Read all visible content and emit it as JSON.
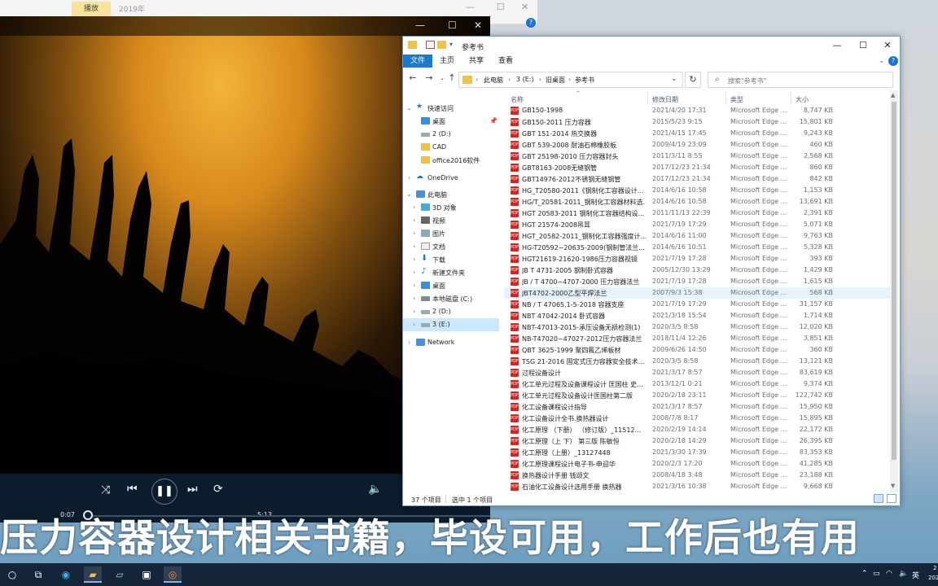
{
  "back_window": {
    "tab_label": "播放",
    "year_label": "2019年",
    "help": "?"
  },
  "player": {
    "time_elapsed": "0:07",
    "time_total": "5:13",
    "progress": 0.022
  },
  "explorer": {
    "title": "参考书",
    "ribbon_tabs": [
      "文件",
      "主页",
      "共享",
      "查看"
    ],
    "breadcrumb": [
      "此电脑",
      "3 (E:)",
      "旧桌面",
      "参考书"
    ],
    "search_placeholder": "搜索\"参考书\"",
    "nav": {
      "quick_access": "快速访问",
      "quick_items": [
        "桌面",
        "2 (D:)",
        "CAD",
        "office2016软件"
      ],
      "onedrive": "OneDrive",
      "this_pc": "此电脑",
      "pc_items": [
        "3D 对象",
        "视频",
        "图片",
        "文档",
        "下载",
        "新建文件夹",
        "桌面",
        "本地磁盘 (C:)",
        "2 (D:)",
        "3 (E:)"
      ],
      "network": "Network"
    },
    "columns": [
      "名称",
      "修改日期",
      "类型",
      "大小"
    ],
    "files": [
      {
        "name": "GB150-1998",
        "date": "2021/4/20 17:31",
        "type": "Microsoft Edge ...",
        "size": "8,747 KB"
      },
      {
        "name": "GB150-2011 压力容器",
        "date": "2015/5/23 9:15",
        "type": "Microsoft Edge ...",
        "size": "15,801 KB"
      },
      {
        "name": "GBT 151-2014 热交换器",
        "date": "2021/4/15 17:45",
        "type": "Microsoft Edge ...",
        "size": "9,243 KB"
      },
      {
        "name": "GBT 539-2008 耐油石棉橡胶板",
        "date": "2009/4/19 23:09",
        "type": "Microsoft Edge ...",
        "size": "460 KB"
      },
      {
        "name": "GBT 25198-2010 压力容器封头",
        "date": "2011/3/11 8:55",
        "type": "Microsoft Edge ...",
        "size": "2,568 KB"
      },
      {
        "name": "GBT8163-2008无缝钢管",
        "date": "2017/12/23 21:34",
        "type": "Microsoft Edge ...",
        "size": "860 KB"
      },
      {
        "name": "GBT14976-2012不锈钢无缝钢管",
        "date": "2017/12/23 21:34",
        "type": "Microsoft Edge ...",
        "size": "842 KB"
      },
      {
        "name": "HG_T20580-2011《钢制化工容器设计...",
        "date": "2014/6/16 10:58",
        "type": "Microsoft Edge ...",
        "size": "1,153 KB"
      },
      {
        "name": "HG/T_20581-2011_钢制化工容器材料选...",
        "date": "2014/6/16 10:58",
        "type": "Microsoft Edge ...",
        "size": "13,691 KB"
      },
      {
        "name": "HGT 20583-2011 钢制化工容器结构设...",
        "date": "2011/11/13 22:39",
        "type": "Microsoft Edge ...",
        "size": "2,391 KB"
      },
      {
        "name": "HGT 21574-2008吊耳",
        "date": "2021/7/19 17:29",
        "type": "Microsoft Edge ...",
        "size": "5,071 KB"
      },
      {
        "name": "HGT_20582-2011_钢制化工容器强度计...",
        "date": "2014/6/16 11:00",
        "type": "Microsoft Edge ...",
        "size": "9,763 KB"
      },
      {
        "name": "HG-T20592~20635-2009(钢制管法兰...",
        "date": "2014/6/16 10:51",
        "type": "Microsoft Edge ...",
        "size": "5,328 KB"
      },
      {
        "name": "HGT21619-21620-1986压力容器视镜",
        "date": "2021/7/19 17:28",
        "type": "Microsoft Edge ...",
        "size": "393 KB"
      },
      {
        "name": "JB T 4731-2005 钢制卧式容器",
        "date": "2005/12/30 13:29",
        "type": "Microsoft Edge ...",
        "size": "1,429 KB"
      },
      {
        "name": "JB / T 4700~4707-2000 压力容器法兰",
        "date": "2021/7/19 17:28",
        "type": "Microsoft Edge ...",
        "size": "1,615 KB"
      },
      {
        "name": "JBT4702-2000乙型平焊法兰",
        "date": "2007/9/3 15:38",
        "type": "Microsoft Edge ...",
        "size": "568 KB",
        "selected": true
      },
      {
        "name": "NB / T 47065.1-5-2018 容器支座",
        "date": "2021/7/19 17:29",
        "type": "Microsoft Edge ...",
        "size": "31,157 KB"
      },
      {
        "name": "NBT 47042-2014 卧式容器",
        "date": "2021/3/18 15:54",
        "type": "Microsoft Edge ...",
        "size": "1,714 KB"
      },
      {
        "name": "NBT-47013-2015-承压设备无损检测(1)",
        "date": "2020/3/5 8:58",
        "type": "Microsoft Edge ...",
        "size": "12,020 KB"
      },
      {
        "name": "NB-T47020~47027-2012压力容器法兰",
        "date": "2018/11/4 12:26",
        "type": "Microsoft Edge ...",
        "size": "3,851 KB"
      },
      {
        "name": "QBT 3625-1999 聚四氟乙烯板材",
        "date": "2009/6/26 14:50",
        "type": "Microsoft Edge ...",
        "size": "360 KB"
      },
      {
        "name": "TSG 21-2016 固定式压力容器安全技术...",
        "date": "2020/3/5 8:58",
        "type": "Microsoft Edge ...",
        "size": "13,121 KB"
      },
      {
        "name": "过程设备设计",
        "date": "2021/3/17 8:57",
        "type": "Microsoft Edge ...",
        "size": "83,619 KB"
      },
      {
        "name": "化工单元过程及设备课程设计 匡国柱 史...",
        "date": "2013/12/1 0:21",
        "type": "Microsoft Edge ...",
        "size": "9,374 KB"
      },
      {
        "name": "化工单元过程及设备设计匡国柱第二版",
        "date": "2020/2/18 23:11",
        "type": "Microsoft Edge ...",
        "size": "122,742 KB"
      },
      {
        "name": "化工设备课程设计指导",
        "date": "2021/3/17 8:57",
        "type": "Microsoft Edge ...",
        "size": "15,950 KB"
      },
      {
        "name": "化工设备设计全书.换热器设计",
        "date": "2008/7/8 8:17",
        "type": "Microsoft Edge ...",
        "size": "15,895 KB"
      },
      {
        "name": "化工原理 （下册） （修订版）_11512...",
        "date": "2020/2/19 14:14",
        "type": "Microsoft Edge ...",
        "size": "22,172 KB"
      },
      {
        "name": "化工原理（上 下） 第三版 陈敏恒",
        "date": "2020/2/18 14:29",
        "type": "Microsoft Edge ...",
        "size": "26,395 KB"
      },
      {
        "name": "化工原理（上册）_13127448",
        "date": "2021/3/30 17:39",
        "type": "Microsoft Edge ...",
        "size": "83,353 KB"
      },
      {
        "name": "化工原理课程设计电子书-申迎华",
        "date": "2020/2/3 17:20",
        "type": "Microsoft Edge ...",
        "size": "41,285 KB"
      },
      {
        "name": "换热器设计手册 钱颂文",
        "date": "2008/4/18 3:48",
        "type": "Microsoft Edge ...",
        "size": "23,188 KB"
      },
      {
        "name": "石油化工设备设计选用手册 换热器",
        "date": "2021/3/16 10:38",
        "type": "Microsoft Edge ...",
        "size": "9,668 KB"
      }
    ],
    "status_count": "37 个项目",
    "status_selected": "选中 1 个项目"
  },
  "subtitle": "压力容器设计相关书籍，毕设可用，工作后也有用",
  "taskbar": {
    "tray_lang": "英",
    "clock_top": "2",
    "clock_bottom": "202"
  },
  "colors": {
    "accent": "#1979ca",
    "pdf_icon": "#d8231f",
    "folder": "#f0c24a",
    "taskbar": "#14253a",
    "selection": "#cce8ff"
  }
}
